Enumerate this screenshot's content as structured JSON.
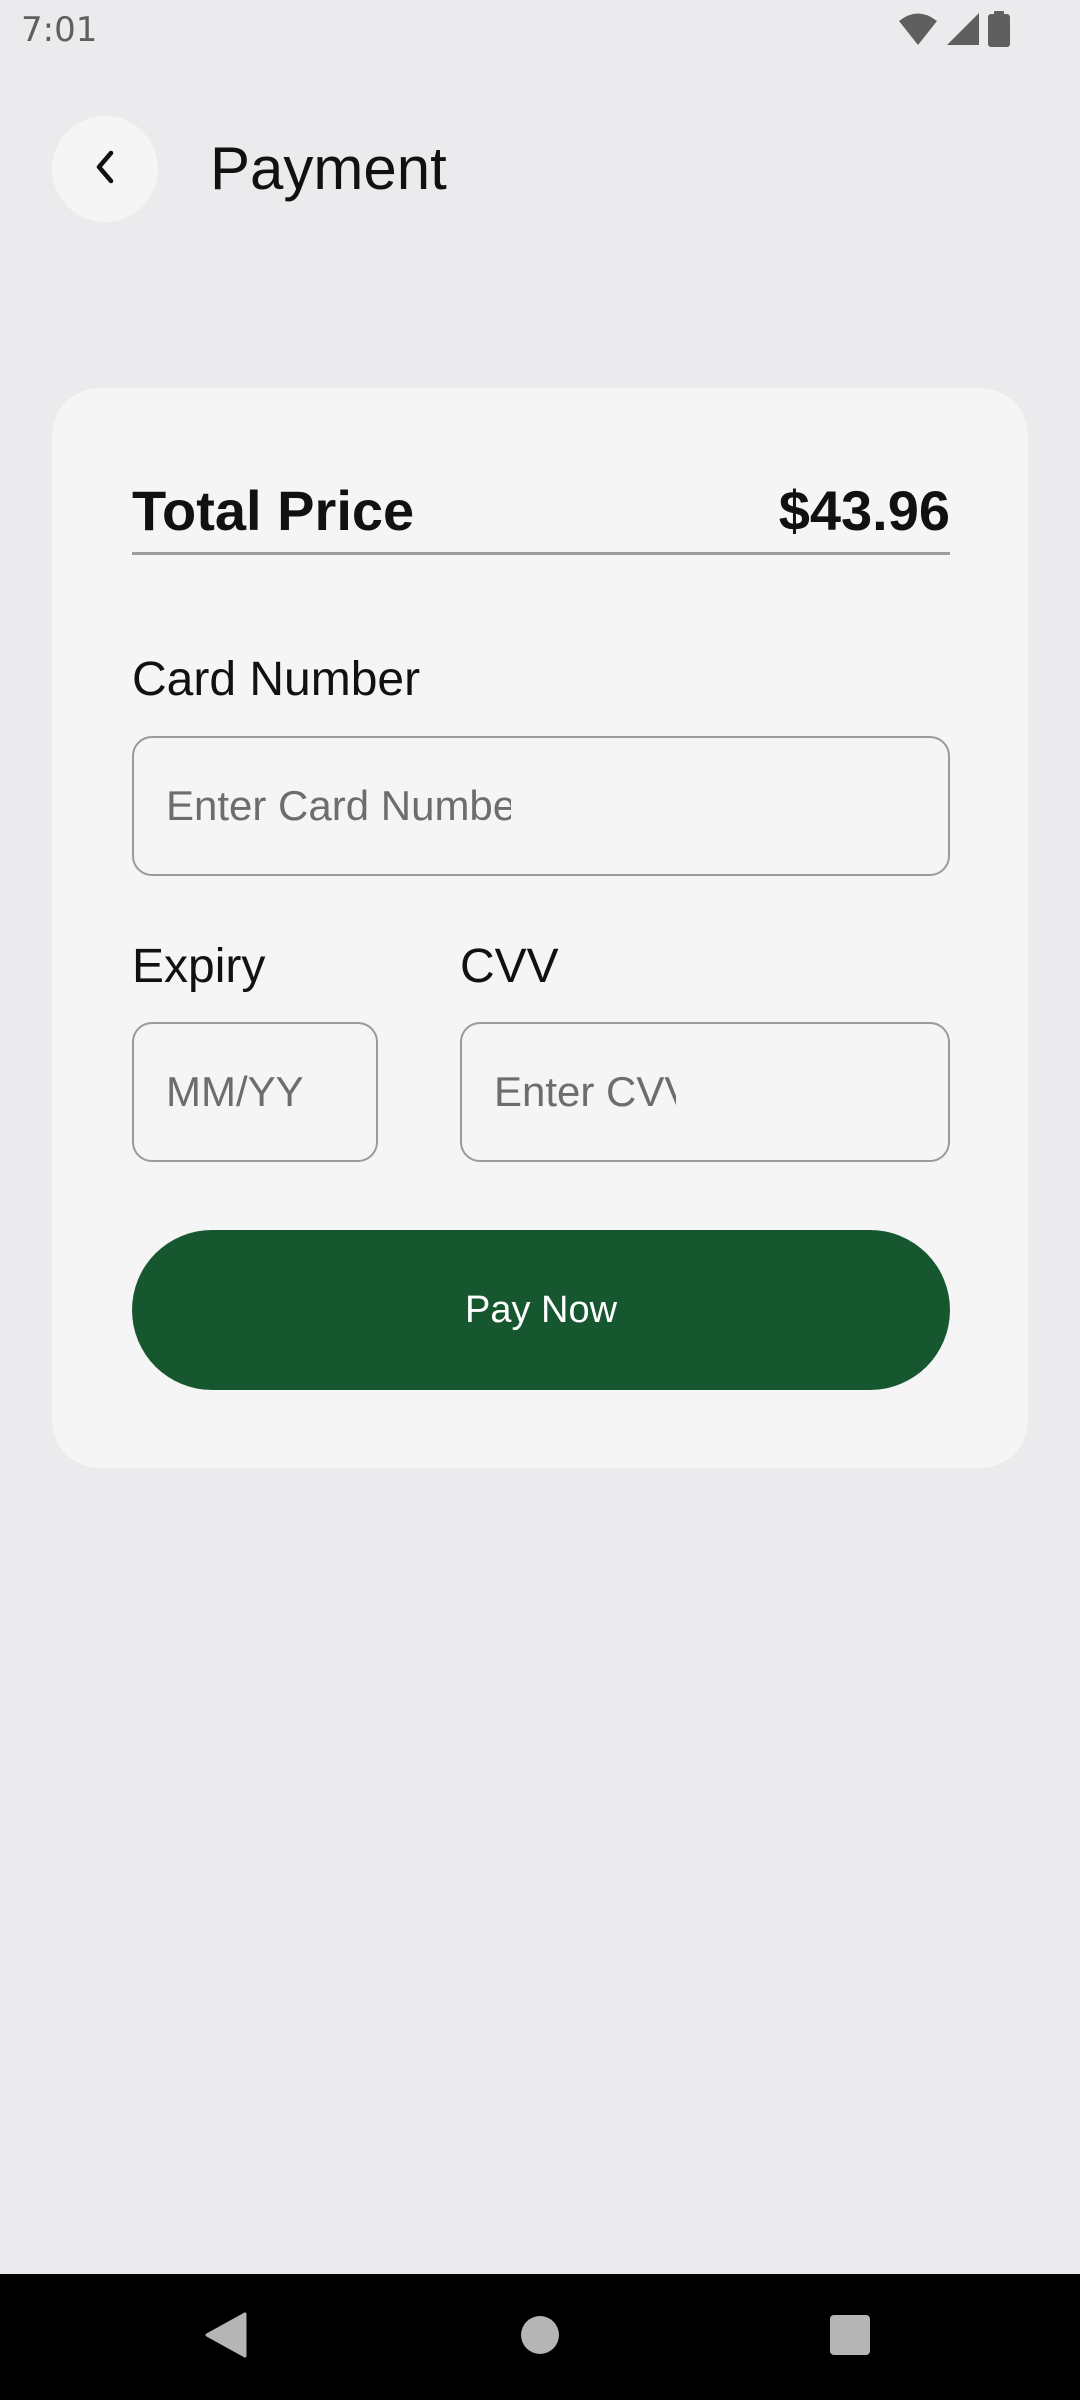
{
  "status_bar": {
    "time": "7:01",
    "icons": [
      "wifi-icon",
      "cellular-signal-icon",
      "battery-icon"
    ]
  },
  "header": {
    "back_icon": "chevron-left-icon",
    "title": "Payment"
  },
  "summary": {
    "total_label": "Total Price",
    "total_value": "$43.96"
  },
  "form": {
    "card_number": {
      "label": "Card Number",
      "placeholder": "Enter Card Number",
      "value": ""
    },
    "expiry": {
      "label": "Expiry",
      "placeholder": "MM/YY",
      "value": ""
    },
    "cvv": {
      "label": "CVV",
      "placeholder": "Enter CVV",
      "value": ""
    },
    "submit_label": "Pay Now"
  },
  "nav_bar": {
    "items": [
      "back-triangle-icon",
      "home-circle-icon",
      "recents-square-icon"
    ]
  },
  "colors": {
    "background": "#ebebed",
    "card": "#f5f5f5",
    "primary": "#175730",
    "nav_bar": "#000000"
  }
}
